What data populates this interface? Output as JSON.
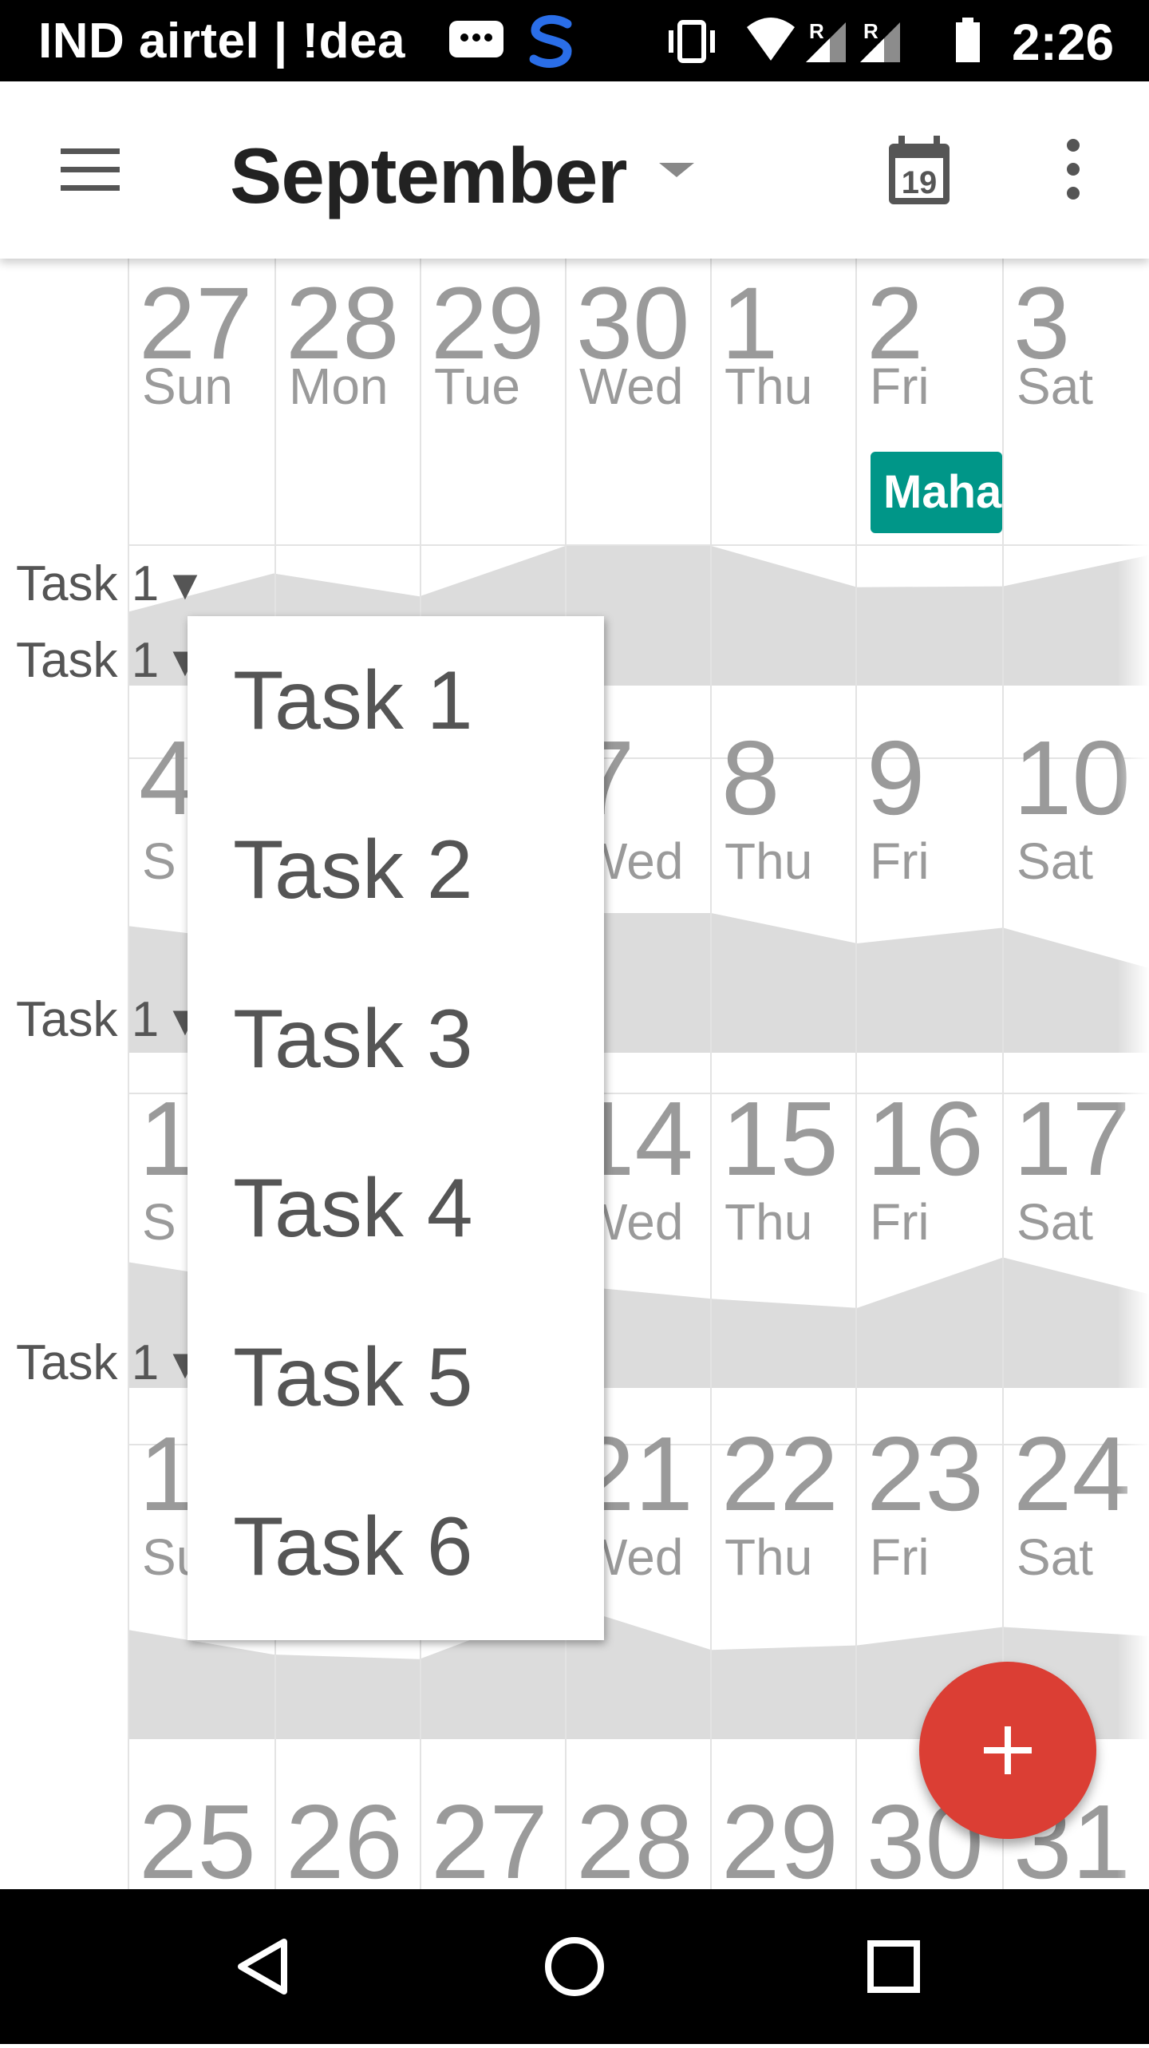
{
  "status_bar": {
    "carrier": "IND airtel | !dea",
    "time": "2:26",
    "roaming_mark": "R"
  },
  "app_bar": {
    "title": "September",
    "calendar_icon_day": "19",
    "icons": [
      "menu-icon",
      "dropdown-caret-icon",
      "calendar-today-icon",
      "more-vert-icon"
    ]
  },
  "weeks": [
    {
      "days": [
        {
          "num": "27",
          "name": "Sun"
        },
        {
          "num": "28",
          "name": "Mon"
        },
        {
          "num": "29",
          "name": "Tue"
        },
        {
          "num": "30",
          "name": "Wed"
        },
        {
          "num": "1",
          "name": "Thu"
        },
        {
          "num": "2",
          "name": "Fri"
        },
        {
          "num": "3",
          "name": "Sat"
        }
      ],
      "task_label": "Task 1 ▾",
      "event": "Maha"
    },
    {
      "days": [
        {
          "num": "4",
          "name": "S"
        },
        {
          "num": "",
          "name": ""
        },
        {
          "num": "",
          "name": ""
        },
        {
          "num": "7",
          "name": "Wed"
        },
        {
          "num": "8",
          "name": "Thu"
        },
        {
          "num": "9",
          "name": "Fri"
        },
        {
          "num": "10",
          "name": "Sat"
        }
      ],
      "task_label": "Task 1 ▾"
    },
    {
      "days": [
        {
          "num": "11",
          "name": "S"
        },
        {
          "num": "",
          "name": ""
        },
        {
          "num": "",
          "name": ""
        },
        {
          "num": "14",
          "name": "Wed"
        },
        {
          "num": "15",
          "name": "Thu"
        },
        {
          "num": "16",
          "name": "Fri"
        },
        {
          "num": "17",
          "name": "Sat"
        }
      ],
      "task_label": "Task 1 ▾"
    },
    {
      "days": [
        {
          "num": "18",
          "name": "Su"
        },
        {
          "num": "",
          "name": ""
        },
        {
          "num": "",
          "name": ""
        },
        {
          "num": "21",
          "name": "Wed"
        },
        {
          "num": "22",
          "name": "Thu"
        },
        {
          "num": "23",
          "name": "Fri"
        },
        {
          "num": "24",
          "name": "Sat"
        }
      ],
      "task_label": "Task 1 ▾"
    },
    {
      "days": [
        {
          "num": "25",
          "name": ""
        },
        {
          "num": "26",
          "name": ""
        },
        {
          "num": "27",
          "name": ""
        },
        {
          "num": "28",
          "name": ""
        },
        {
          "num": "29",
          "name": ""
        },
        {
          "num": "30",
          "name": ""
        },
        {
          "num": "31",
          "name": ""
        }
      ]
    }
  ],
  "dropdown": {
    "items": [
      "Task 1",
      "Task 2",
      "Task 3",
      "Task 4",
      "Task 5",
      "Task 6"
    ]
  },
  "fab": {
    "label": "+"
  },
  "nav_bar": {
    "icons": [
      "back-icon",
      "home-icon",
      "recents-icon"
    ]
  },
  "colors": {
    "accent": "#db3e34",
    "event_chip": "#009688",
    "area_fill": "#dcdcdc",
    "day_text": "#9a9a9a"
  }
}
